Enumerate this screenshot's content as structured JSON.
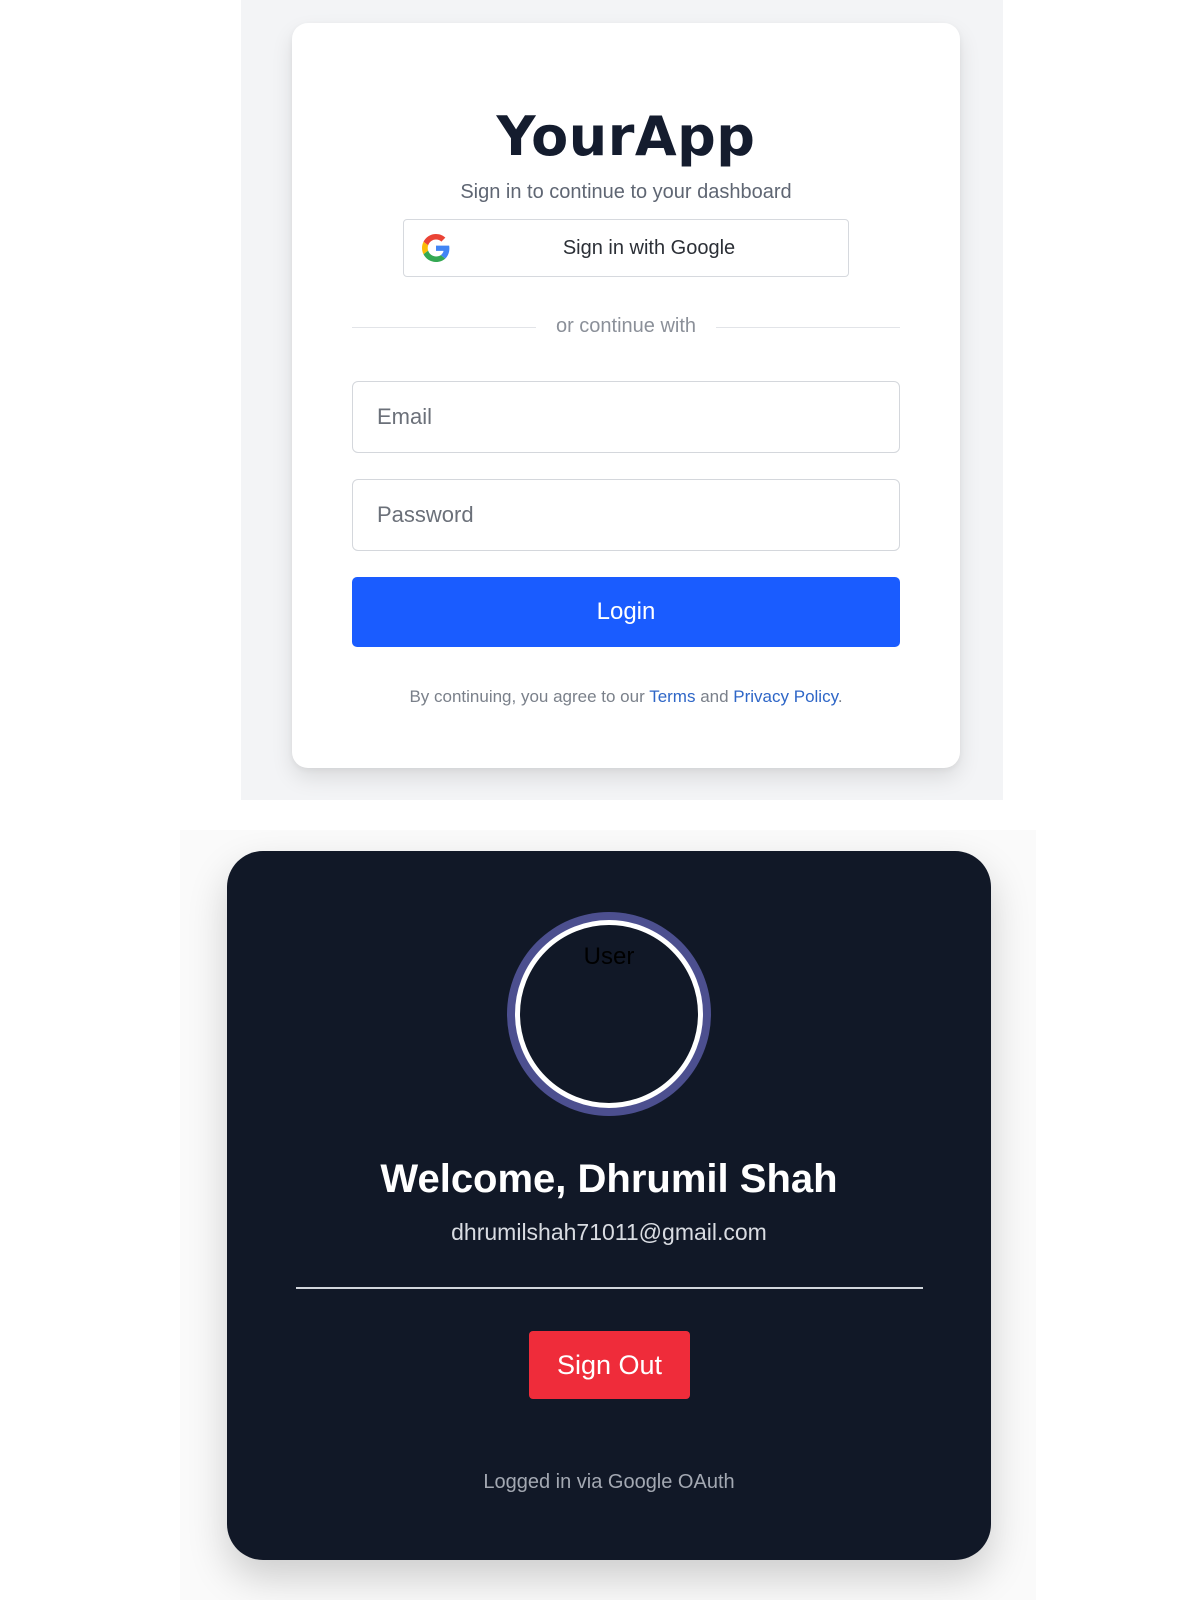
{
  "login": {
    "app_title": "YourApp",
    "subtitle": "Sign in to continue to your dashboard",
    "google_button_label": "Sign in with Google",
    "divider_text": "or continue with",
    "email_placeholder": "Email",
    "password_placeholder": "Password",
    "login_button_label": "Login",
    "legal_prefix": "By continuing, you agree to our ",
    "terms_link": "Terms",
    "legal_and": " and ",
    "privacy_link": "Privacy Policy",
    "legal_suffix": ".",
    "accent_color": "#1a5cff"
  },
  "welcome": {
    "avatar_alt": "User",
    "title": "Welcome, Dhrumil Shah",
    "email": "dhrumilshah71011@gmail.com",
    "sign_out_label": "Sign Out",
    "login_method": "Logged in via Google OAuth",
    "card_color": "#111827",
    "sign_out_color": "#ef2c3a"
  },
  "icons": {
    "google": "google-g-icon"
  }
}
